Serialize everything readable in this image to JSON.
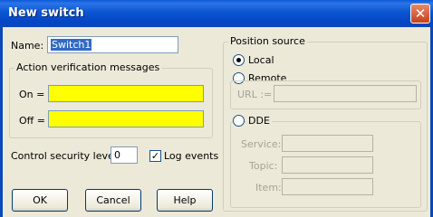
{
  "window": {
    "title": "New switch",
    "close_glyph": "✕"
  },
  "name_field": {
    "label": "Name:",
    "value": "Switch1"
  },
  "action_messages": {
    "title": "Action verification messages",
    "on_label": "On =",
    "on_value": "",
    "off_label": "Off =",
    "off_value": ""
  },
  "security": {
    "label": "Control security level:",
    "value": "0"
  },
  "log_events": {
    "label": "Log events",
    "checked": true,
    "check_glyph": "✓"
  },
  "buttons": {
    "ok": "OK",
    "cancel": "Cancel",
    "help": "Help"
  },
  "position_source": {
    "title": "Position source",
    "local_label": "Local",
    "remote_label": "Remote",
    "url_label": "URL :=",
    "url_value": "",
    "selected": "Local"
  },
  "dde": {
    "label": "DDE",
    "service_label": "Service:",
    "topic_label": "Topic:",
    "item_label": "Item:",
    "service_value": "",
    "topic_value": "",
    "item_value": ""
  },
  "colors": {
    "title_bar": "#0a5bd6",
    "message_field": "#ffff00",
    "dialog_bg": "#ece9d8"
  }
}
